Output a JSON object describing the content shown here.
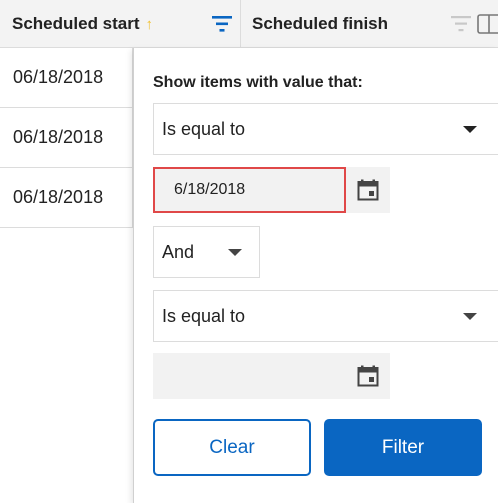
{
  "columns": {
    "scheduled_start": "Scheduled start",
    "scheduled_finish": "Scheduled finish",
    "sort_indicator": "↑"
  },
  "rows": [
    "06/18/2018",
    "06/18/2018",
    "06/18/2018"
  ],
  "filter": {
    "title": "Show items with value that:",
    "condition1": "Is equal to",
    "value1": "6/18/2018",
    "operator": "And",
    "condition2": "Is equal to",
    "value2": "",
    "clear_label": "Clear",
    "filter_label": "Filter"
  },
  "icons": {
    "filter_active": "filter-icon",
    "filter_inactive": "filter-icon",
    "calendar": "calendar-icon",
    "panel_toggle": "panel-toggle-icon"
  },
  "colors": {
    "accent": "#0a66c2",
    "highlight": "#e04848",
    "sort": "#f1c232"
  }
}
